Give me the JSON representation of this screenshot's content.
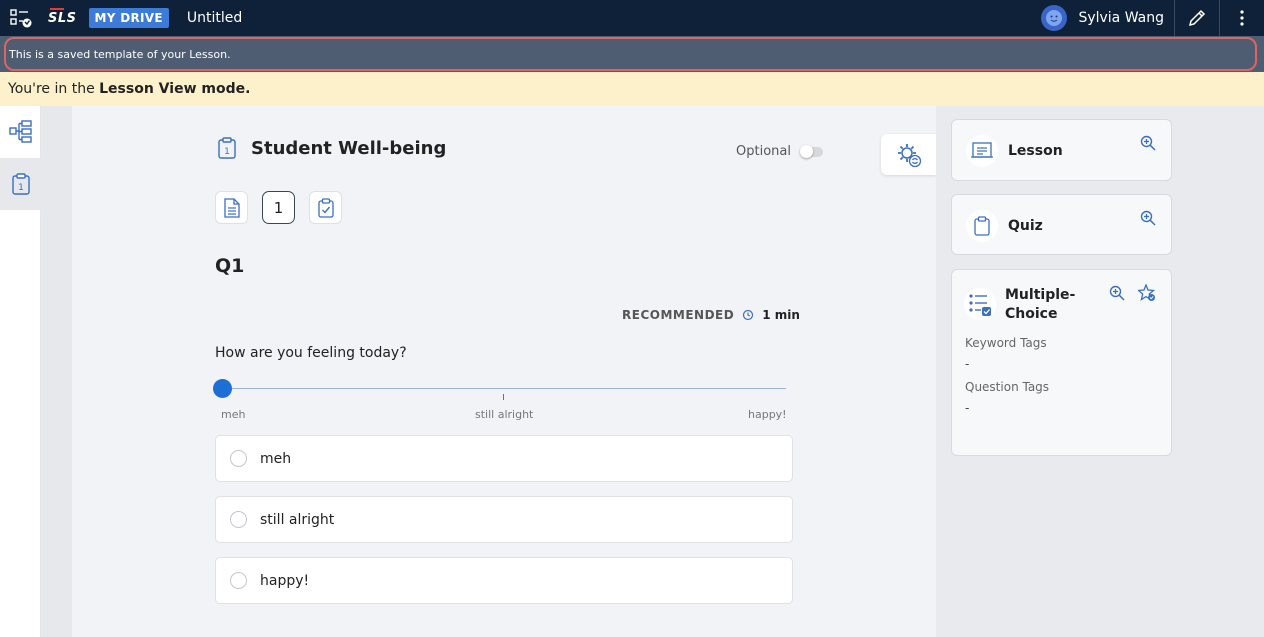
{
  "topbar": {
    "logo": "SLS",
    "drive_badge": "MY DRIVE",
    "doc_title": "Untitled",
    "user_name": "Sylvia Wang"
  },
  "template_banner": "This is a saved template of your Lesson.",
  "mode_banner": {
    "prefix": "You're in the ",
    "mode": "Lesson View mode."
  },
  "question": {
    "title": "Student Well-being",
    "optional_label": "Optional",
    "optional_on": false,
    "mini_buttons": [
      "",
      "1",
      ""
    ],
    "label": "Q1",
    "recommended_label": "RECOMMENDED",
    "recommended_time": "1 min",
    "prompt": "How are you feeling today?",
    "slider": {
      "labels": [
        "meh",
        "still alright",
        "happy!"
      ],
      "selected_index": 0
    },
    "options": [
      "meh",
      "still alright",
      "happy!"
    ]
  },
  "right_panel": {
    "lesson_card": {
      "title": "Lesson"
    },
    "quiz_card": {
      "title": "Quiz"
    },
    "mcq_card": {
      "title_line1": "Multiple-",
      "title_line2": "Choice",
      "keyword_tags_label": "Keyword Tags",
      "keyword_tags_value": "-",
      "question_tags_label": "Question Tags",
      "question_tags_value": "-"
    }
  },
  "colors": {
    "topbar": "#0f2139",
    "accent": "#3d7bd8",
    "template_banner": "#4f5d73",
    "mode_banner": "#fdf1cc",
    "slider_thumb": "#1d6fd6"
  }
}
